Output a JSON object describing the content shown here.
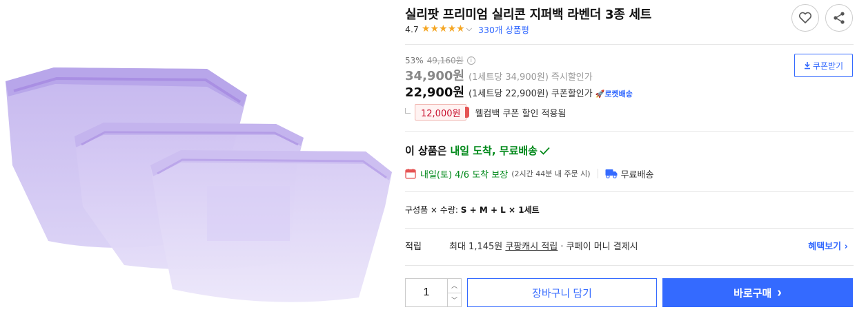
{
  "product": {
    "title": "실리팟 프리미엄 실리콘 지퍼백 라벤더 3종 세트",
    "rating": "4.7",
    "review_count": "330개 상품평",
    "stars": 5
  },
  "price": {
    "discount_rate": "53%",
    "original_price": "49,160원",
    "instant_price": "34,900원",
    "instant_unit": "(1세트당 34,900원)",
    "instant_label": "즉시할인가",
    "coupon_price": "22,900원",
    "coupon_unit": "(1세트당 22,900원)",
    "coupon_label": "쿠폰할인가",
    "rocket_badge": "로켓배송",
    "coupon_button": "쿠폰받기"
  },
  "welcome": {
    "amount": "12,000원",
    "text": "웰컴백 쿠폰 할인 적용됨"
  },
  "delivery": {
    "head_prefix": "이 상품은",
    "head_green": "내일 도착, 무료배송",
    "arrival": "내일(토) 4/6 도착 보장",
    "order_note": "(2시간 44분 내 주문 시)",
    "free_shipping": "무료배송"
  },
  "option": {
    "label": "구성품 × 수량:",
    "value": "S + M + L × 1세트"
  },
  "points": {
    "label": "적립",
    "text_prefix": "최대 1,145원",
    "text_link": "쿠팡캐시 적립",
    "text_suffix": "· 쿠페이 머니 결제시",
    "benefit_link": "혜택보기"
  },
  "purchase": {
    "quantity": "1",
    "cart_label": "장바구니 담기",
    "buy_label": "바로구매",
    "buy_chevron": "›"
  },
  "colors": {
    "accent": "#346aff",
    "green": "#00891a",
    "star": "#f5a623",
    "coupon_red": "#c8102e",
    "bag_purple": "#c9b8ef"
  },
  "icons": [
    "heart-icon",
    "share-icon",
    "info-icon",
    "download-icon",
    "rocket-icon",
    "calendar-icon",
    "truck-icon",
    "check-icon",
    "chevron-down-icon",
    "chevron-up-icon",
    "chevron-right-icon"
  ]
}
